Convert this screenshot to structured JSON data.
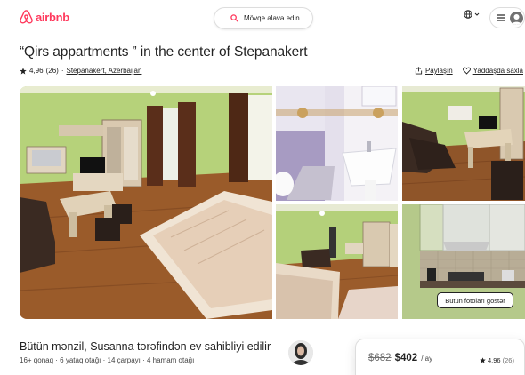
{
  "header": {
    "logo_text": "airbnb",
    "search_placeholder": "Mövqe əlavə edin",
    "brand_color": "#ff385c"
  },
  "listing": {
    "title": "“Qirs appartments ” in the center of Stepanakert",
    "rating": "4,96",
    "review_count": "(26)",
    "separator": "·",
    "location": "Stepanakert, Azerbaijan",
    "share_label": "Paylaşın",
    "save_label": "Yaddaşda saxla"
  },
  "photos": {
    "show_all_label": "Bütün fotoları göstər"
  },
  "host": {
    "title": "Bütün mənzil, Susanna tərəfindən ev sahibliyi edilir",
    "details": "16+ qonaq · 6 yataq otağı · 14  çarpayı · 4 hamam otağı"
  },
  "booking": {
    "old_price": "$682",
    "new_price": "$402",
    "per": "/ ay",
    "rating": "4,96",
    "review_count": "(26)"
  }
}
